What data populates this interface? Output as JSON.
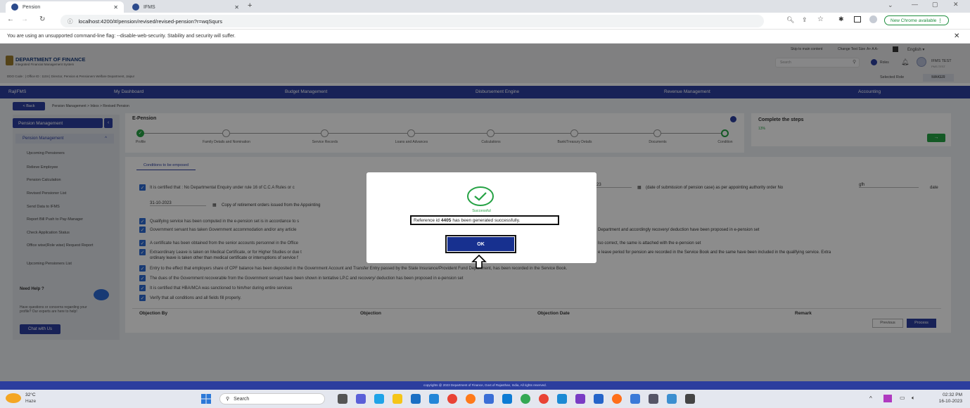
{
  "browser": {
    "tabs": [
      {
        "label": "Pension"
      },
      {
        "label": "IFMS"
      }
    ],
    "url": "localhost:4200/#/pension/revised/revised-pension?r=wqSqurs",
    "new_chrome": "New Chrome available",
    "warning": "You are using an unsupported command-line flag: --disable-web-security. Stability and security will suffer."
  },
  "header": {
    "org_name": "DEPARTMENT OF FINANCE",
    "org_sub": "Integrated Financial Management System",
    "ddo_info": "DDO Code : | Office ID : 1104 | Director, Pension & Pensioners Welfare Department, Jaipur",
    "skip": "Skip to main content",
    "text_size": "Change Text Size",
    "font_sizes": "A+  A  A-",
    "language": "English",
    "search_placeholder": "Search",
    "roles": "Roles",
    "user_name": "IFMS TEST",
    "user_sub": "PMS.TEST",
    "selected_role_label": "Selected Role",
    "selected_role": "MAKER"
  },
  "nav": {
    "logo": "RajIFMS",
    "items": [
      "My Dashboard",
      "Budget Management",
      "Disbursement Engine",
      "Revenue Management",
      "Accounting"
    ]
  },
  "breadcrumb": {
    "back": "< Back",
    "path": "Pension Management  >  Inbox > Revised Pension"
  },
  "sidebar": {
    "title": "Pension Management",
    "section": "Pension Management",
    "items": [
      "Upcoming Pensioners",
      "Relieve Employee",
      "Pension Calculation",
      "Revised Pensioner List",
      "Send Data to IFMS",
      "Report Bill Push to Pay-Manager",
      "Check Application Status",
      "Office wise(Role wise) Request Report",
      "Upcoming Pensioners List"
    ],
    "need_help": "Need Help ?",
    "help_text": "Have questions or concerns regarding your profile? Our experts are here to help!",
    "chat": "Chat with Us"
  },
  "epension": {
    "title": "E-Pension",
    "steps": [
      "Profile",
      "Family Details and Nomination",
      "Service Records",
      "Loans and Advances",
      "Calculations",
      "Bank/Treasury Details",
      "Documents",
      "Condition"
    ]
  },
  "steps_panel": {
    "title": "Complete the steps",
    "percent": "13%"
  },
  "conditions": {
    "tab": "Conditions to be emposed",
    "row1_left": "It is certified that : No Departmental Enquiry under rule 16 of C.C.A Rules or c",
    "row1_date": "23",
    "row1_right": "(date of submission of pension case) as per appointing authority order No",
    "row1_order": "gfh",
    "row1_end": "date",
    "row2_date": "31-10-2023",
    "row2_text": "Copy of retirement orders issued from the Appointing",
    "items": [
      {
        "left": "Qualifying service has been computed in the e-pension set is in accordance to s",
        "right": ""
      },
      {
        "left": "Government servant has taken Government accommodation and/or any article",
        "right": "Department and accordingly recovery/ deduction have been proposed in e-pension set"
      },
      {
        "left": "A certificate has been obtained from the senior accounts personnel in the Office",
        "right": "lso correct, the same is attached with the e-pension set"
      },
      {
        "left": "Extraordinary Leave is taken on Medical Certificate, or for Higher Studies or due t",
        "right": "e leave period for pension are recorded in the Service Book and the same have been included in the qualifying service. Extra"
      },
      {
        "left": "Entry to the effect that employers share of CPF balance has been deposited in the Government Account and Transfer Entry passed by the State Insurance/Provident Fund Department, has been recorded in the Service Book.",
        "right": ""
      },
      {
        "left": "The dues of the Government recoverable from the Government servant have been shown in tentative LP.C and recovery/ deduction has been proposed in e-pension set",
        "right": ""
      },
      {
        "left": "It is certified that  HBA/MCA was sanctioned to him/her during entire services",
        "right": ""
      },
      {
        "left": "Verify that all conditions and all fields fill properly.",
        "right": ""
      }
    ],
    "extra_line": "ordinary leave is taken other than medical certificate or interruptions of service f",
    "columns": [
      "Objection By",
      "Objection",
      "Objection Date",
      "Remark"
    ],
    "previous": "Previous",
    "process": "Process"
  },
  "footer": "copyrights @ 2023 Department of Finance, Govt.of Rajasthan, India, All rights reserved.",
  "modal": {
    "status": "Successful",
    "ref_prefix": "Reference id ",
    "ref_id": "4405",
    "ref_suffix": " has been generated successfully.",
    "ok": "OK"
  },
  "taskbar": {
    "weather_temp": "32°C",
    "weather_text": "Haze",
    "search": "Search",
    "time": "02:32 PM",
    "date": "16-10-2023"
  }
}
